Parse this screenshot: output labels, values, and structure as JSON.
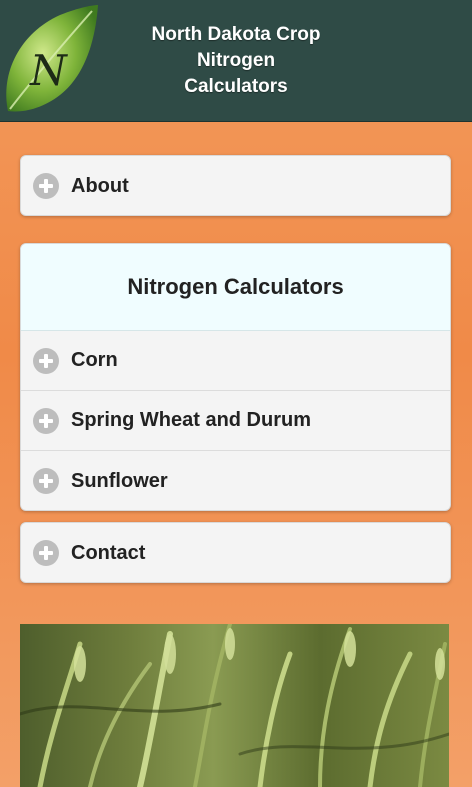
{
  "header": {
    "title_lines": [
      "North Dakota Crop",
      "Nitrogen",
      "Calculators"
    ],
    "logo_icon": "leaf-n-logo-icon"
  },
  "about": {
    "label": "About"
  },
  "calculators": {
    "heading": "Nitrogen Calculators",
    "items": [
      {
        "label": "Corn"
      },
      {
        "label": "Spring Wheat and Durum"
      },
      {
        "label": "Sunflower"
      }
    ]
  },
  "contact": {
    "label": "Contact"
  },
  "colors": {
    "header_bg": "#2f4b46",
    "page_bg": "#f08a48",
    "panel_bg": "#f4f4f4",
    "section_head_bg": "#f0fdff",
    "icon_gray": "#bdbdbd"
  },
  "icons": {
    "expand": "plus-circle-icon"
  }
}
